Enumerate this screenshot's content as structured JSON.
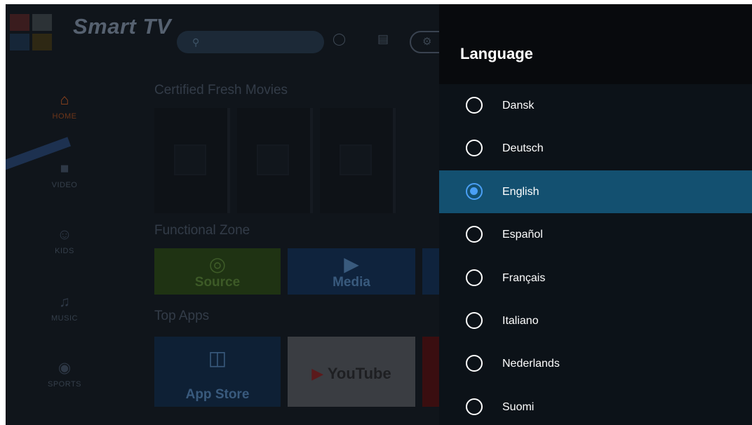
{
  "launcher": {
    "app_title": "Smart TV",
    "search_icon": "search-icon",
    "sidebar": [
      {
        "label": "HOME",
        "icon": "home-icon",
        "glyph": "⌂"
      },
      {
        "label": "VIDEO",
        "icon": "video-icon",
        "glyph": "■"
      },
      {
        "label": "KIDS",
        "icon": "kids-icon",
        "glyph": "☺"
      },
      {
        "label": "MUSIC",
        "icon": "music-icon",
        "glyph": "♫"
      },
      {
        "label": "SPORTS",
        "icon": "sports-icon",
        "glyph": "◉"
      }
    ],
    "sections": {
      "movies": "Certified Fresh Movies",
      "functional": "Functional Zone",
      "apps": "Top Apps"
    },
    "functional_tiles": [
      {
        "label": "Source",
        "color": "#1f3313"
      },
      {
        "label": "Media",
        "color": "#0f233d"
      }
    ],
    "app_tiles": [
      {
        "label": "App Store",
        "color": "#0e2035"
      },
      {
        "label": "YouTube",
        "color": "#3a3d42"
      }
    ]
  },
  "panel": {
    "title": "Language",
    "selected": "English",
    "accent_color": "#4a9ff5",
    "selected_bg": "#135070",
    "options": [
      "Dansk",
      "Deutsch",
      "English",
      "Español",
      "Français",
      "Italiano",
      "Nederlands",
      "Suomi"
    ]
  }
}
